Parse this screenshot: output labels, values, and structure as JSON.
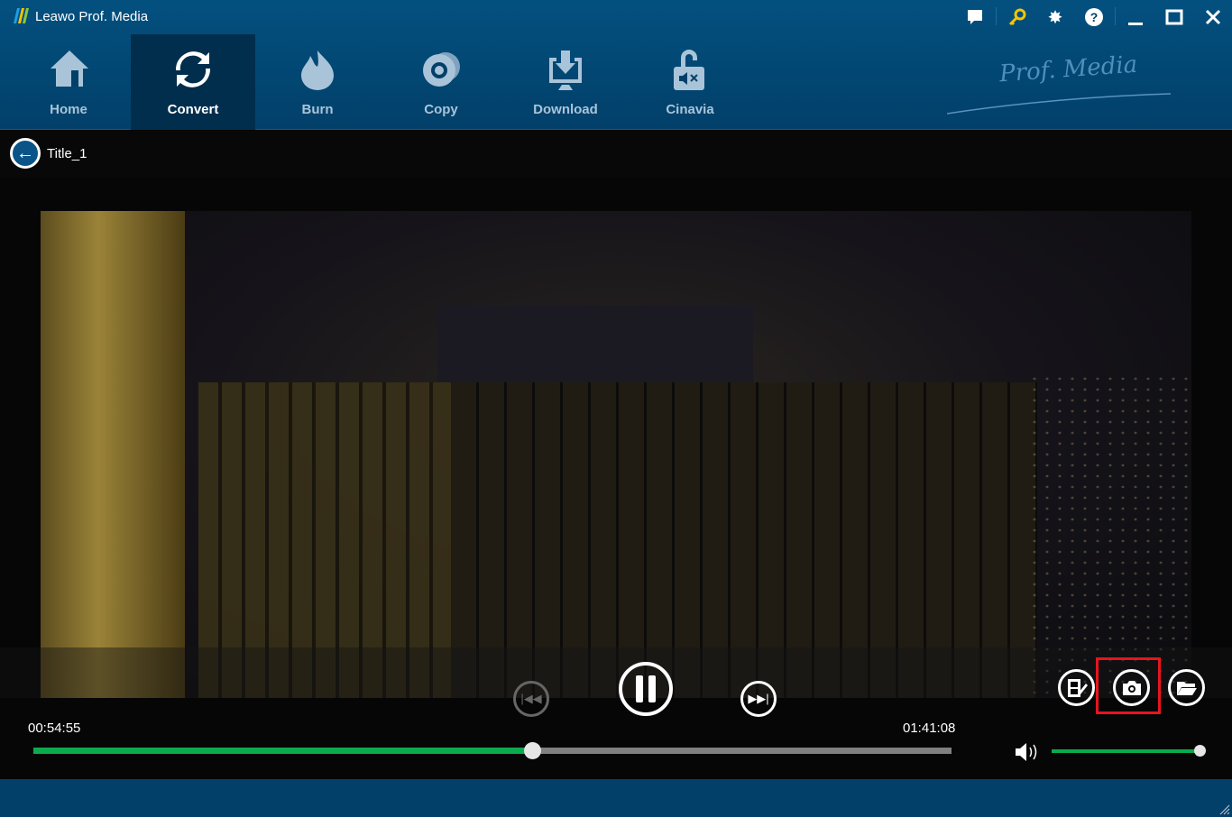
{
  "app": {
    "title": "Leawo Prof. Media",
    "brand": "Prof. Media"
  },
  "nav": [
    {
      "label": "Home",
      "icon": "home-icon"
    },
    {
      "label": "Convert",
      "icon": "convert-icon",
      "active": true
    },
    {
      "label": "Burn",
      "icon": "flame-icon"
    },
    {
      "label": "Copy",
      "icon": "disc-icon"
    },
    {
      "label": "Download",
      "icon": "download-icon"
    },
    {
      "label": "Cinavia",
      "icon": "unlock-icon"
    }
  ],
  "window_controls": [
    "feedback-icon",
    "key-icon",
    "gear-icon",
    "help-icon",
    "minimize-icon",
    "maximize-icon",
    "close-icon"
  ],
  "player": {
    "title": "Title_1",
    "current_time": "00:54:55",
    "total_time": "01:41:08",
    "progress": 0.543,
    "volume": 1.0,
    "accent": "#0bab4d",
    "highlight_color": "#e8141e"
  }
}
